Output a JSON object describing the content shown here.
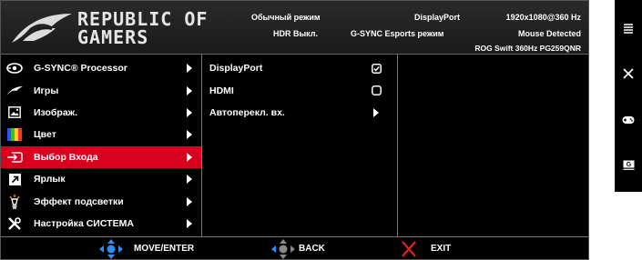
{
  "brand": {
    "line1": "REPUBLIC OF",
    "line2": "GAMERS"
  },
  "status": {
    "mode": "Обычный режим",
    "hdr": "HDR Выкл.",
    "input": "DisplayPort",
    "gsync": "G-SYNC Esports режим",
    "resolution": "1920x1080@360 Hz",
    "mouse": "Mouse Detected",
    "model": "ROG Swift 360Hz PG259QNR"
  },
  "menu": {
    "items": [
      {
        "label": "G-SYNC® Processor",
        "icon": "gsync-icon"
      },
      {
        "label": "Игры",
        "icon": "rog-gaming-icon"
      },
      {
        "label": "Изображ.",
        "icon": "image-icon"
      },
      {
        "label": "Цвет",
        "icon": "color-icon"
      },
      {
        "label": "Выбор Входа",
        "icon": "input-select-icon"
      },
      {
        "label": "Ярлык",
        "icon": "shortcut-icon"
      },
      {
        "label": "Эффект подсветки",
        "icon": "light-effect-icon"
      },
      {
        "label": "Настройка СИСТЕМА",
        "icon": "system-setup-icon"
      }
    ],
    "selected_index": 4
  },
  "submenu": {
    "items": [
      {
        "label": "DisplayPort",
        "control": "checked"
      },
      {
        "label": "HDMI",
        "control": "unchecked"
      },
      {
        "label": "Автоперекл. вх.",
        "control": "arrow"
      }
    ]
  },
  "footer": {
    "move": "MOVE/ENTER",
    "back": "BACK",
    "exit": "EXIT"
  },
  "colors": {
    "accent": "#d8001f",
    "nav_blue": "#2f8ff0",
    "exit_red": "#e22222"
  },
  "side_panel": [
    {
      "icon": "menu-icon"
    },
    {
      "icon": "close-icon"
    },
    {
      "icon": "gamepad-icon"
    },
    {
      "icon": "gameplus-icon"
    }
  ]
}
